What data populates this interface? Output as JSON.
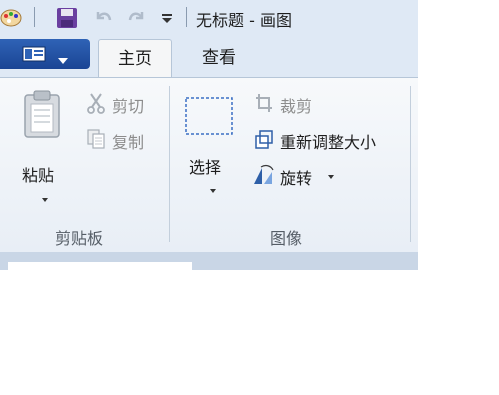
{
  "title_bar": {
    "title": "无标题 - 画图"
  },
  "tabs": {
    "home": "主页",
    "view": "查看"
  },
  "clipboard": {
    "paste": "粘贴",
    "cut": "剪切",
    "copy": "复制",
    "group_label": "剪贴板"
  },
  "image": {
    "select": "选择",
    "crop": "裁剪",
    "resize": "重新调整大小",
    "rotate": "旋转",
    "group_label": "图像"
  },
  "colors": {
    "file_button": "#1a4594",
    "ribbon_bg": "#e8eef6",
    "title_bg": "#dfe9f5"
  }
}
